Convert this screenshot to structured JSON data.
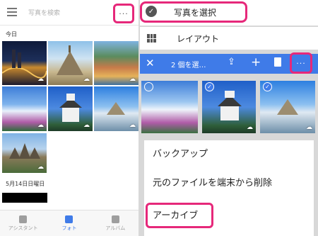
{
  "left": {
    "search_placeholder": "写真を検索",
    "more_label": "···",
    "today_label": "今日",
    "date_label": "5月14日日曜日",
    "nav": [
      {
        "label": "アシスタント",
        "icon": "assistant-icon"
      },
      {
        "label": "フォト",
        "icon": "photos-icon"
      },
      {
        "label": "アルバム",
        "icon": "albums-icon"
      }
    ]
  },
  "right": {
    "select_label": "写真を選択",
    "layout_label": "レイアウト",
    "action_bar": {
      "close_label": "✕",
      "count_label": "2 個を選…",
      "share_label": "⇪",
      "add_label": "+",
      "more_label": "···"
    },
    "menu": [
      {
        "label": "バックアップ"
      },
      {
        "label": "元のファイルを端末から削除"
      },
      {
        "label": "アーカイブ"
      }
    ]
  },
  "colors": {
    "accent": "#3f7be8",
    "highlight": "#e6287a"
  }
}
